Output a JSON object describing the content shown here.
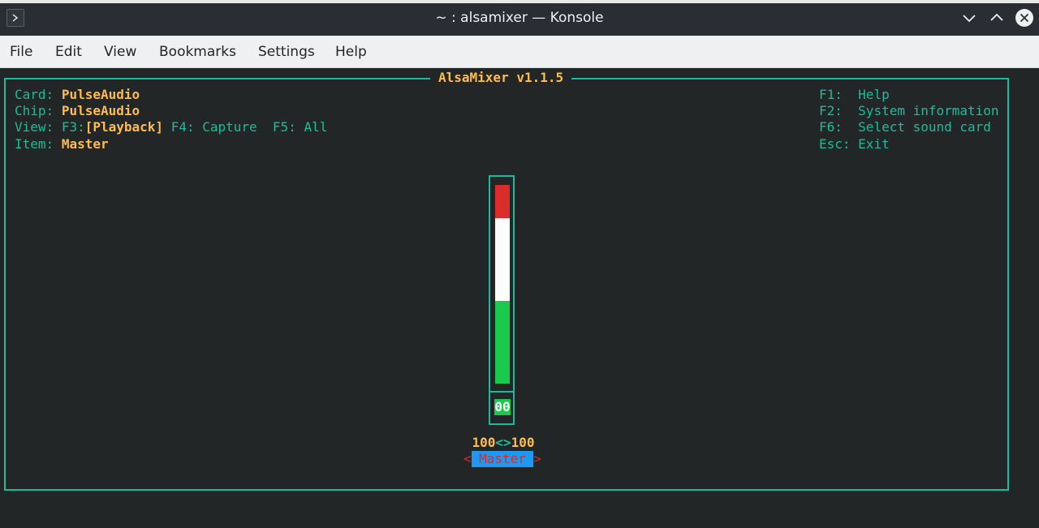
{
  "window": {
    "title": "~ : alsamixer — Konsole"
  },
  "menubar": {
    "items": [
      "File",
      "Edit",
      "View",
      "Bookmarks",
      "Settings",
      "Help"
    ]
  },
  "mixer": {
    "title": "AlsaMixer v1.1.5",
    "card_label": "Card:",
    "card_value": "PulseAudio",
    "chip_label": "Chip:",
    "chip_value": "PulseAudio",
    "view_label": "View:",
    "view_f3": "F3:",
    "view_playback": "[Playback]",
    "view_f4": "F4: Capture",
    "view_f5": "F5: All",
    "item_label": "Item:",
    "item_value": "Master",
    "help": [
      {
        "key": "F1:",
        "label": "Help"
      },
      {
        "key": "F2:",
        "label": "System information"
      },
      {
        "key": "F6:",
        "label": "Select sound card"
      },
      {
        "key": "Esc:",
        "label": "Exit"
      }
    ],
    "channel": {
      "name": "Master",
      "mute_badge": "00",
      "left_volume": "100",
      "separator": "<>",
      "right_volume": "100",
      "bracket_left": "<",
      "bracket_right": ">",
      "level_fraction": 1.0
    }
  },
  "colors": {
    "accent_cyan": "#1abc9c",
    "value_yellow": "#fdbc4b",
    "meter_red": "#da2c2a",
    "meter_white": "#fcfcfc",
    "meter_green": "#1bca4c",
    "label_blue": "#1d99f3"
  },
  "icons": {
    "app": "terminal-prompt-icon",
    "minimize": "chevron-down-icon",
    "maximize": "chevron-up-icon",
    "close": "close-icon"
  }
}
